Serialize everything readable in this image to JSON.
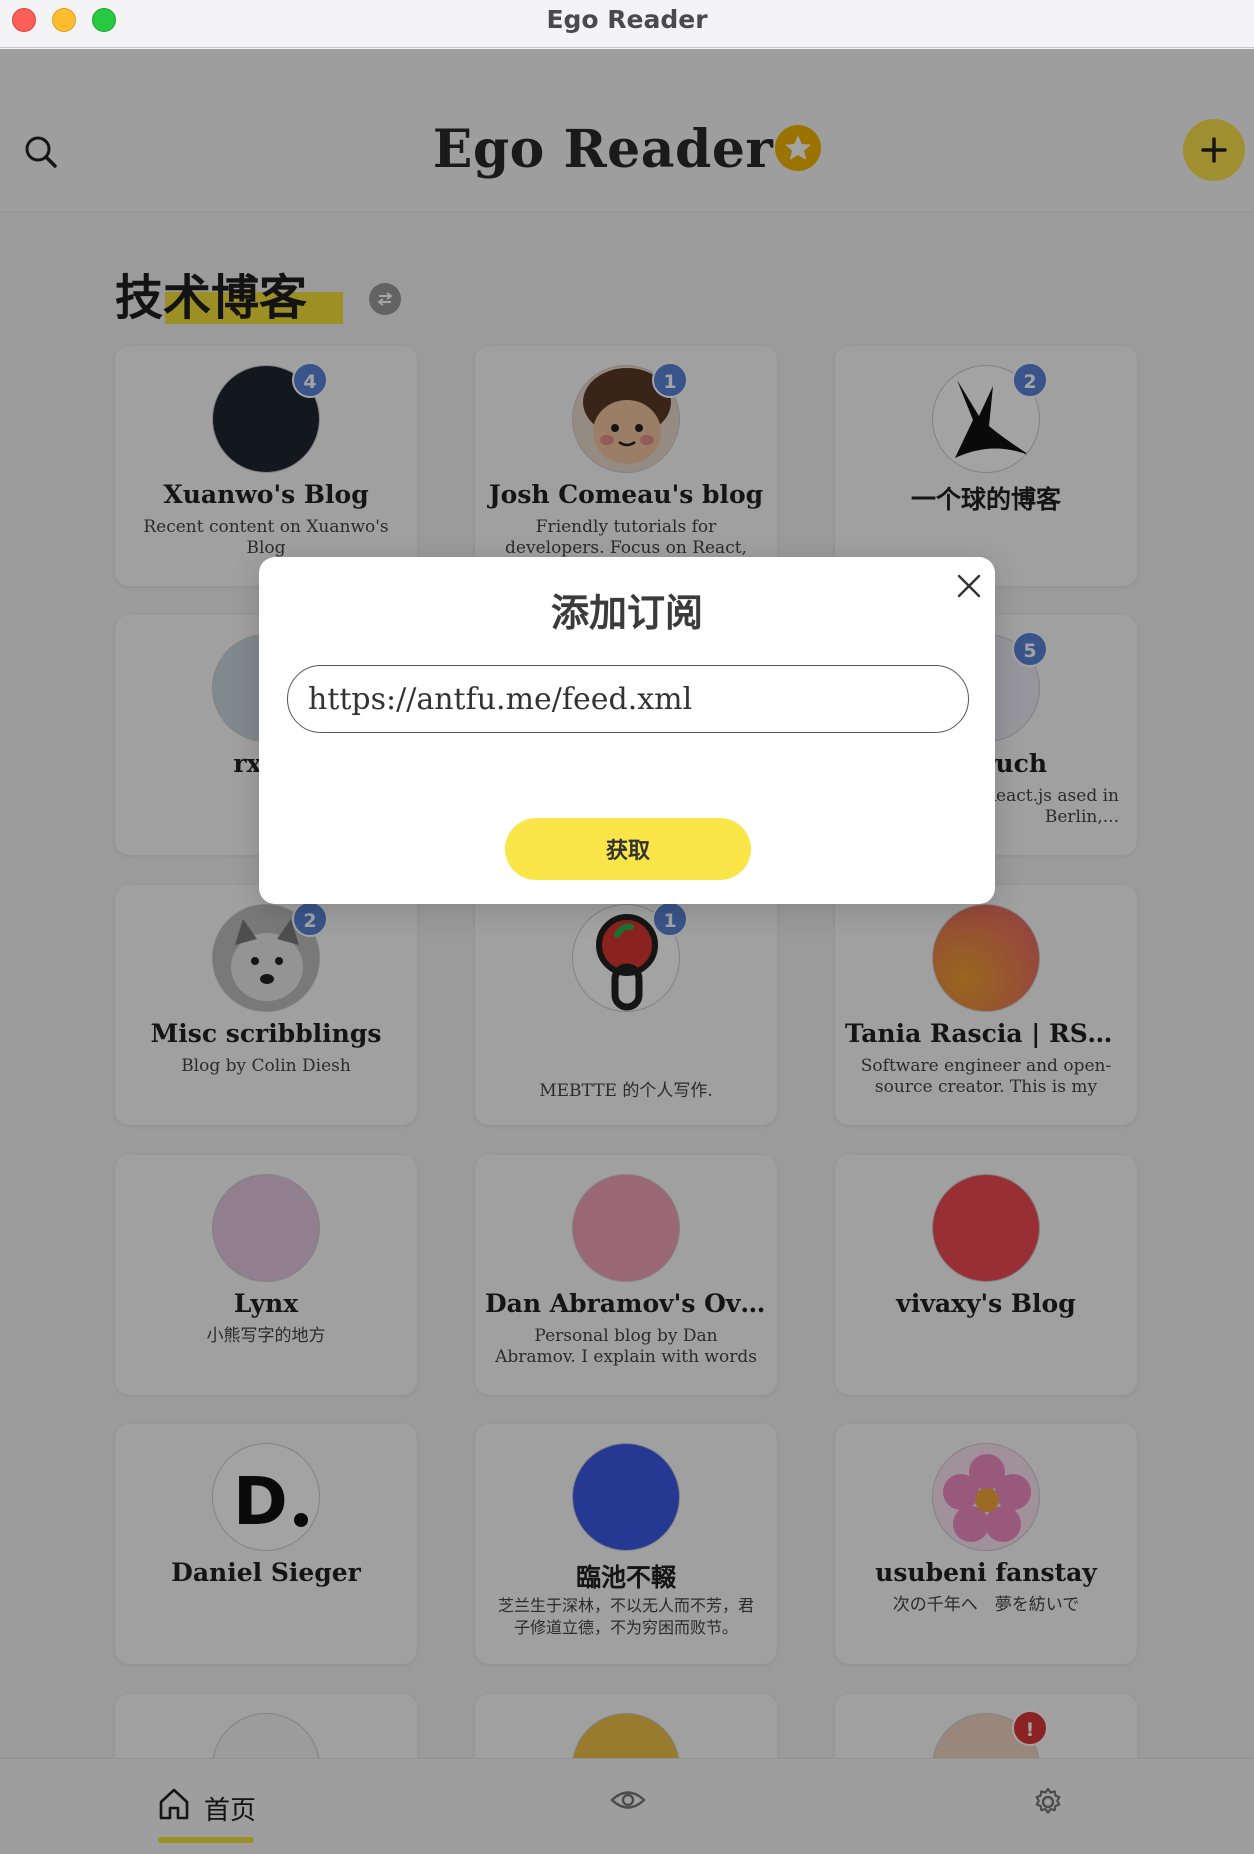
{
  "window": {
    "title": "Ego Reader"
  },
  "header": {
    "app_title": "Ego Reader",
    "search_icon": "search-icon",
    "add_icon": "plus-icon",
    "star_icon": "star-icon"
  },
  "section": {
    "title": "技术博客"
  },
  "feeds": [
    {
      "title": "Xuanwo's Blog",
      "desc": "Recent content on Xuanwo's Blog",
      "unread": "4"
    },
    {
      "title": "Josh Comeau's blog",
      "desc": "Friendly tutorials for developers. Focus on React, CSS, animation...",
      "unread": "1"
    },
    {
      "title": "一个球的博客",
      "desc": "",
      "unread": "2"
    },
    {
      "title": "rxliu",
      "desc": "",
      "unread": ""
    },
    {
      "title": "",
      "desc": "",
      "unread": ""
    },
    {
      "title": "ruch",
      "desc": "per for React.js ased in Berlin,...",
      "unread": "5"
    },
    {
      "title": "Misc scribblings",
      "desc": "Blog by Colin Diesh",
      "unread": "2"
    },
    {
      "title": "",
      "desc": "MEBTTE 的个人写作.",
      "unread": "1"
    },
    {
      "title": "Tania Rascia | RSS F...",
      "desc": "Software engineer and open-source creator. This is my digit...",
      "unread": ""
    },
    {
      "title": "Lynx",
      "desc": "小熊写字的地方",
      "unread": ""
    },
    {
      "title": "Dan Abramov's Ove...",
      "desc": "Personal blog by Dan Abramov. I explain with words and code.",
      "unread": ""
    },
    {
      "title": "vivaxy's Blog",
      "desc": "",
      "unread": ""
    },
    {
      "title": "Daniel Sieger",
      "desc": "",
      "unread": ""
    },
    {
      "title": "臨池不輟",
      "desc": "芝兰生于深林，不以无人而不芳，君子修道立德，不为穷困而败节。",
      "unread": ""
    },
    {
      "title": "usubeni fanstay",
      "desc": "次の千年へ　夢を紡いで",
      "unread": ""
    },
    {
      "title": "",
      "desc": "",
      "unread": ""
    },
    {
      "title": "",
      "desc": "",
      "unread": ""
    },
    {
      "title": "",
      "desc": "",
      "unread": "!"
    }
  ],
  "bottom_nav": {
    "home_label": "首页",
    "home_icon": "home-icon",
    "eye_icon": "eye-icon",
    "settings_icon": "gear-icon"
  },
  "modal": {
    "title": "添加订阅",
    "input_value": "https://antfu.me/feed.xml",
    "button_label": "获取",
    "close_icon": "close-icon"
  },
  "colors": {
    "accent_yellow": "#f9e04b",
    "badge_blue": "#5a84d8",
    "badge_red": "#d9383a",
    "star_gold": "#f1b400"
  }
}
